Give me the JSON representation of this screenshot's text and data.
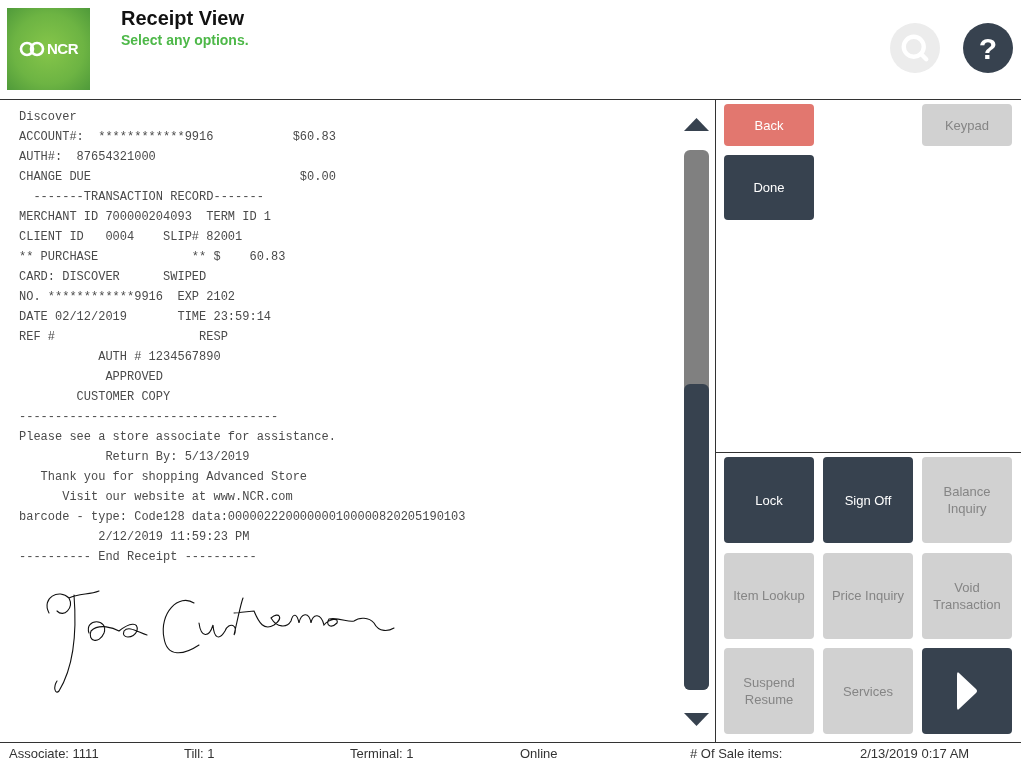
{
  "header": {
    "logo": {
      "text": "NCR"
    },
    "title": "Receipt View",
    "subtitle": "Select any options.",
    "search_button": {
      "disabled": true
    },
    "help_button": {
      "label": "?",
      "disabled": false
    }
  },
  "receipt": {
    "lines": [
      "Discover",
      "ACCOUNT#:  ************9916           $60.83",
      "AUTH#:  87654321000",
      "CHANGE DUE                             $0.00",
      "  -------TRANSACTION RECORD-------",
      "MERCHANT ID 700000204093  TERM ID 1",
      "CLIENT ID   0004    SLIP# 82001",
      "** PURCHASE             ** $    60.83",
      "CARD: DISCOVER      SWIPED",
      "NO. ************9916  EXP 2102",
      "DATE 02/12/2019       TIME 23:59:14",
      "REF #                    RESP",
      "           AUTH # 1234567890",
      "            APPROVED",
      "        CUSTOMER COPY",
      "------------------------------------",
      "Please see a store associate for assistance.",
      "            Return By: 5/13/2019",
      "   Thank you for shopping Advanced Store",
      "      Visit our website at www.NCR.com",
      "barcode - type: Code128 data:000002220000000100000820205190103",
      "           2/12/2019 11:59:23 PM",
      "---------- End Receipt ----------"
    ]
  },
  "top_buttons": [
    {
      "label": "Back",
      "kind": "back",
      "disabled": false
    },
    {
      "label": "Keypad",
      "kind": "action",
      "disabled": true
    },
    {
      "label": "Done",
      "kind": "action",
      "disabled": false
    }
  ],
  "function_buttons": [
    {
      "label": "Lock",
      "kind": "action",
      "disabled": false
    },
    {
      "label": "Sign Off",
      "kind": "action",
      "disabled": false
    },
    {
      "label": "Balance Inquiry",
      "kind": "action",
      "disabled": true
    },
    {
      "label": "Item Lookup",
      "kind": "action",
      "disabled": true
    },
    {
      "label": "Price Inquiry",
      "kind": "action",
      "disabled": true
    },
    {
      "label": "Void Transaction",
      "kind": "action",
      "disabled": true
    },
    {
      "label": "Suspend Resume",
      "kind": "action",
      "disabled": true
    },
    {
      "label": "Services",
      "kind": "action",
      "disabled": true
    },
    {
      "kind": "next",
      "disabled": false
    }
  ],
  "status_bar": [
    "Associate: 1111",
    "Till: 1",
    "Terminal: 1",
    "Online",
    "# Of Sale items:",
    "2/13/2019 0:17 AM"
  ]
}
